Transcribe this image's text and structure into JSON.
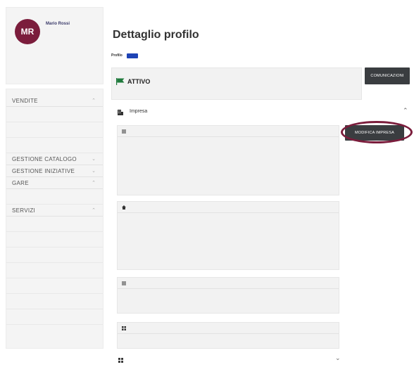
{
  "user": {
    "initials": "MR",
    "name": "Mario Rossi",
    "sub": "",
    "link": ""
  },
  "menu": {
    "sections": [
      {
        "label": "VENDITE",
        "items": [
          "",
          "",
          ""
        ]
      },
      {
        "label": "GESTIONE CATALOGO",
        "items": []
      },
      {
        "label": "GESTIONE INIZIATIVE",
        "items": []
      },
      {
        "label": "GARE",
        "items": [
          ""
        ]
      },
      {
        "label": "SERVIZI",
        "items": [
          "",
          "",
          "",
          "",
          "",
          "",
          ""
        ]
      }
    ]
  },
  "back_link": "",
  "page_title": "Dettaglio profilo",
  "profile": {
    "label": "Profilo",
    "badge": "",
    "meta": "",
    "id_label": "",
    "id_value": ""
  },
  "status": {
    "caption": "",
    "value": "ATTIVO",
    "note": "",
    "date_caption": "",
    "date_value": ""
  },
  "buttons": {
    "comunicazioni": "COMUNICAZIONI",
    "modifica_impresa": "MODIFICA IMPRESA"
  },
  "section": {
    "title": "Impresa"
  },
  "dati_impresa": {
    "title": "",
    "fields": [
      {
        "label": "",
        "value": ""
      },
      {
        "label": "",
        "value": ""
      },
      {
        "label": "",
        "value": ""
      },
      {
        "label": "",
        "value": ""
      },
      {
        "label": "",
        "value": ""
      },
      {
        "label": "",
        "value": ""
      },
      {
        "label": "",
        "value": ""
      }
    ]
  },
  "sede_legale": {
    "title": "",
    "fields": [
      {
        "label": "",
        "value": ""
      },
      {
        "label": "",
        "value": ""
      },
      {
        "label": "",
        "value": ""
      },
      {
        "label": "",
        "value": ""
      },
      {
        "label": "",
        "value": ""
      },
      {
        "label": "",
        "value": ""
      }
    ]
  },
  "contatti": {
    "title": "",
    "fields": [
      {
        "label": "",
        "value": ""
      },
      {
        "label": "",
        "value": ""
      },
      {
        "label": "",
        "value": ""
      }
    ]
  },
  "lista_contatti": {
    "title": "",
    "note": ""
  },
  "bottom_row": {
    "title": ""
  },
  "colors": {
    "brand": "#7b1d3c",
    "badge": "#1e43b5",
    "flag": "#1f7a3c",
    "dark_button": "#3a3d40"
  }
}
